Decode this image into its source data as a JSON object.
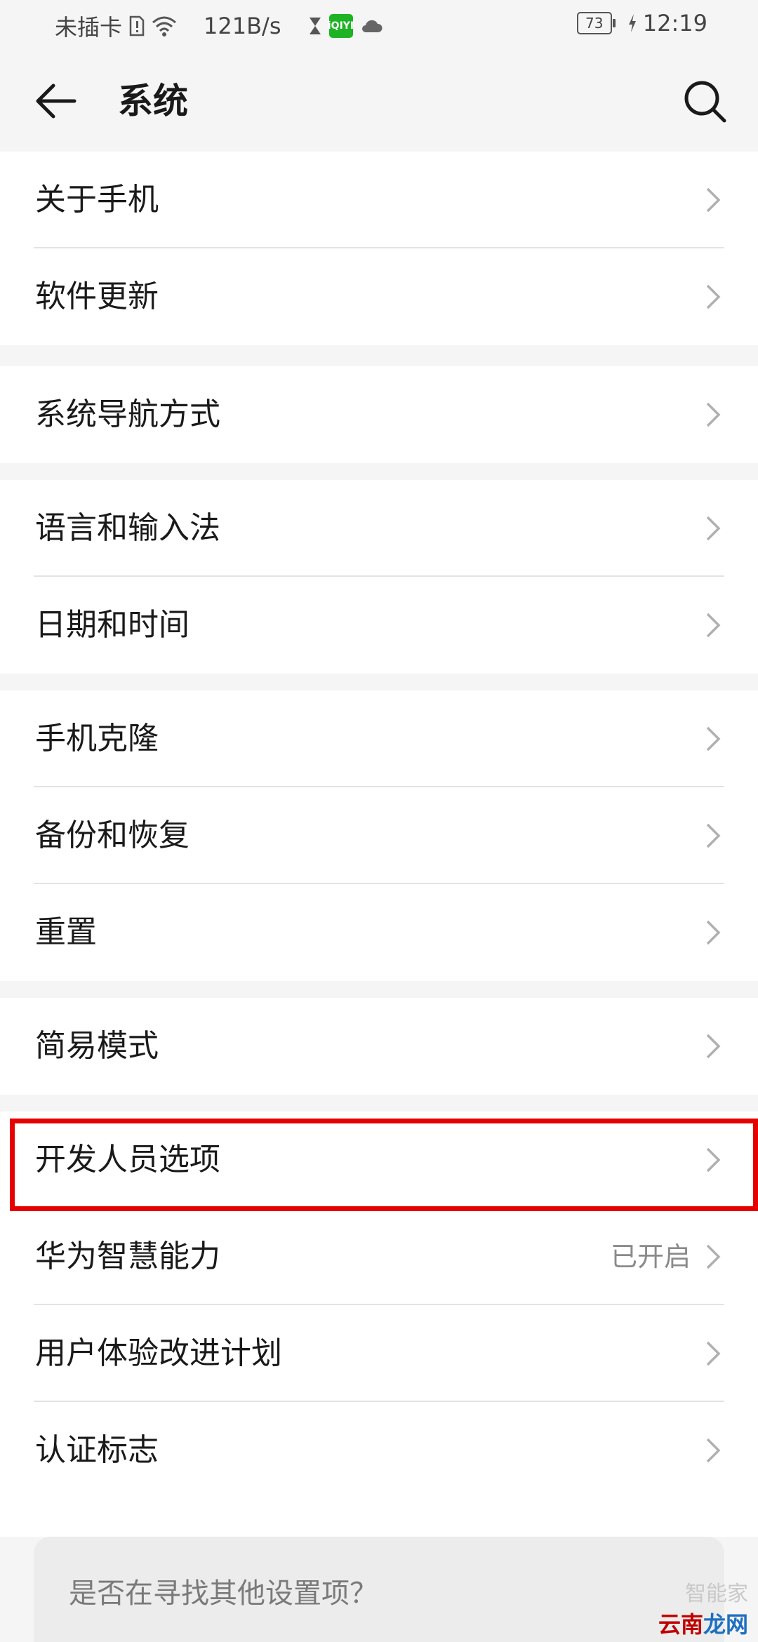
{
  "status_bar": {
    "sim_text": "未插卡",
    "net_speed": "121B/s",
    "iqiyi_label": "iQIYI",
    "battery_level": "73",
    "time": "12:19",
    "icons": [
      "sim-missing-icon",
      "wifi-icon",
      "hourglass-icon",
      "iqiyi-app-icon",
      "cloud-icon",
      "battery-icon",
      "charging-icon"
    ]
  },
  "header": {
    "title": "系统",
    "back_icon": "back-arrow-icon",
    "search_icon": "search-icon"
  },
  "groups": [
    {
      "items": [
        {
          "label": "关于手机"
        },
        {
          "label": "软件更新"
        }
      ]
    },
    {
      "items": [
        {
          "label": "系统导航方式"
        }
      ]
    },
    {
      "items": [
        {
          "label": "语言和输入法"
        },
        {
          "label": "日期和时间"
        }
      ]
    },
    {
      "items": [
        {
          "label": "手机克隆"
        },
        {
          "label": "备份和恢复"
        },
        {
          "label": "重置"
        }
      ]
    },
    {
      "items": [
        {
          "label": "简易模式"
        }
      ]
    },
    {
      "items": [
        {
          "label": "开发人员选项",
          "highlighted": true
        },
        {
          "label": "华为智慧能力",
          "value": "已开启"
        },
        {
          "label": "用户体验改进计划"
        },
        {
          "label": "认证标志"
        }
      ]
    }
  ],
  "suggestion": {
    "text": "是否在寻找其他设置项？"
  },
  "watermark": {
    "line1": "智能家",
    "line2a": "云南",
    "line2b": "龙网"
  },
  "colors": {
    "highlight_border": "#e60000",
    "background": "#f5f5f5",
    "card": "#ffffff"
  }
}
